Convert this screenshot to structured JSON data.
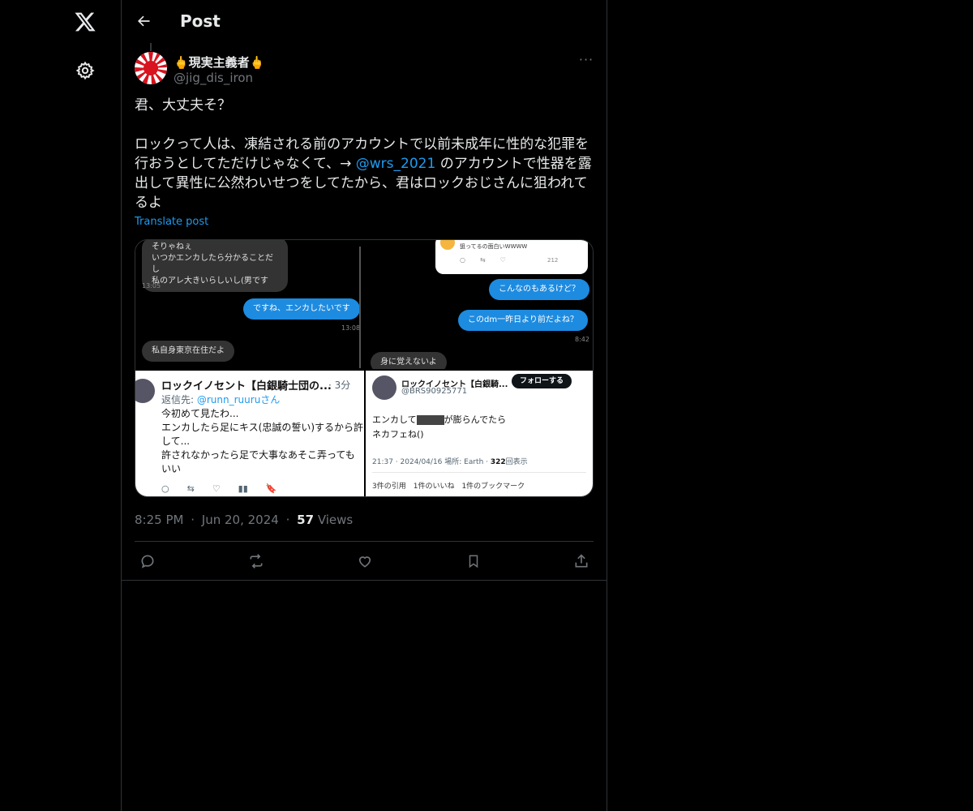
{
  "header": {
    "title": "Post"
  },
  "post": {
    "display_name": "🖕現実主義者🖕",
    "handle": "@jig_dis_iron",
    "more": "···",
    "line1": "君、大丈夫そ？",
    "line2_a": "ロックって人は、凍結される前のアカウントで以前未成年に性的な犯罪を行おうとしてただけじゃなくて、→ ",
    "mention": "@wrs_2021",
    "line2_b": " のアカウントで性器を露出して異性に公然わいせつをしてたから、君はロックおじさんに狙われてるよ",
    "translate": "Translate post",
    "time": "8:25 PM",
    "date": "Jun 20, 2024",
    "views_count": "57",
    "views_label": "Views",
    "dot": "·"
  },
  "media": {
    "img1": {
      "bubble1": "そりゃねぇ\nいつかエンカしたら分かることだし\n私のアレ大きいらしいし(男です",
      "ts1": "13:05",
      "bubble2": "ですね、エンカしたいです",
      "ts2": "13:08",
      "bubble3": "私自身東京在住だよ"
    },
    "img2": {
      "card_text": "狙ってるの面白いWWWW",
      "card_count": "212",
      "bubble1": "こんなのもあるけど？",
      "bubble2": "このdm一昨日より前だよね？",
      "ts": "8:42",
      "bubble3": "身に覚えないよ"
    },
    "img3": {
      "name": "ロックイノセント【白銀騎士団の...",
      "time": "· 3分",
      "reply_label": "返信先: ",
      "reply_to": "@runn_ruuruさん",
      "text": "今初めて見たわ...\nエンカしたら足にキス(忠誠の誓い)するから許して...\n許されなかったら足で大事なあそこ弄ってもいい"
    },
    "img4": {
      "name": "ロックイノセント【白銀騎...",
      "follow": "フォローする",
      "handle": "@BRS90925771",
      "text_a": "エンカして",
      "text_b": "が膨らんでたら",
      "text_c": "ネカフェね()",
      "meta": "21:37 · 2024/04/16 場所: Earth · ",
      "views": "322",
      "views_label": "回表示",
      "stats": "3件の引用　1件のいいね　1件のブックマーク"
    }
  },
  "icons": {
    "logo": "x-logo-icon",
    "settings": "gear-icon",
    "back": "arrow-left-icon",
    "reply": "reply-icon",
    "repost": "repost-icon",
    "like": "heart-icon",
    "bookmark": "bookmark-icon",
    "share": "share-icon"
  },
  "colors": {
    "accent": "#1d9bf0",
    "muted": "#71767b",
    "border": "#2f3336",
    "background": "#000000"
  }
}
